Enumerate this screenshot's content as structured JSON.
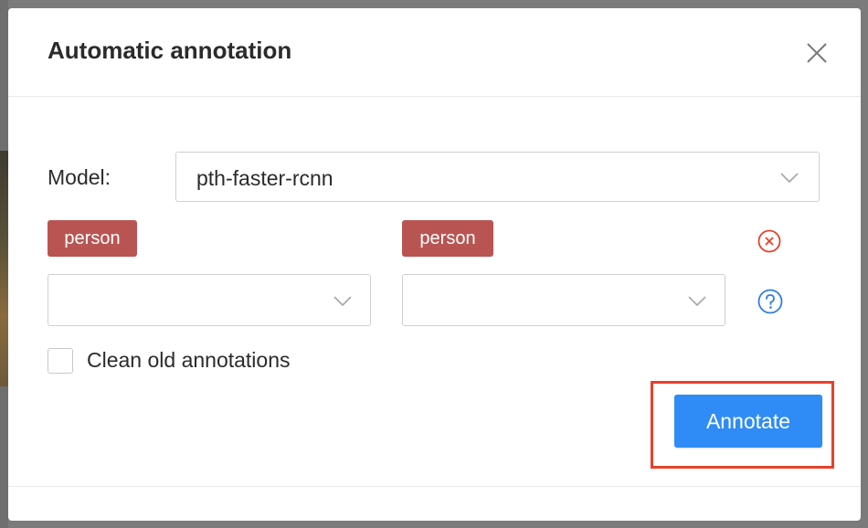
{
  "modal": {
    "title": "Automatic annotation",
    "close_icon": "close-icon"
  },
  "model": {
    "label": "Model:",
    "selected": "pth-faster-rcnn"
  },
  "mapping": {
    "model_label_tag": "person",
    "task_label_tag": "person",
    "model_label_select": "",
    "task_label_select": "",
    "remove_icon": "close-circle-icon",
    "help_icon": "question-circle-icon"
  },
  "options": {
    "clean_old_label": "Clean old annotations",
    "clean_old_checked": false
  },
  "actions": {
    "annotate_label": "Annotate"
  },
  "colors": {
    "tag_bg": "#b85552",
    "primary": "#2f8cf6",
    "highlight": "#e8402a",
    "remove_icon": "#e8402a",
    "help_icon": "#2f7de0"
  }
}
